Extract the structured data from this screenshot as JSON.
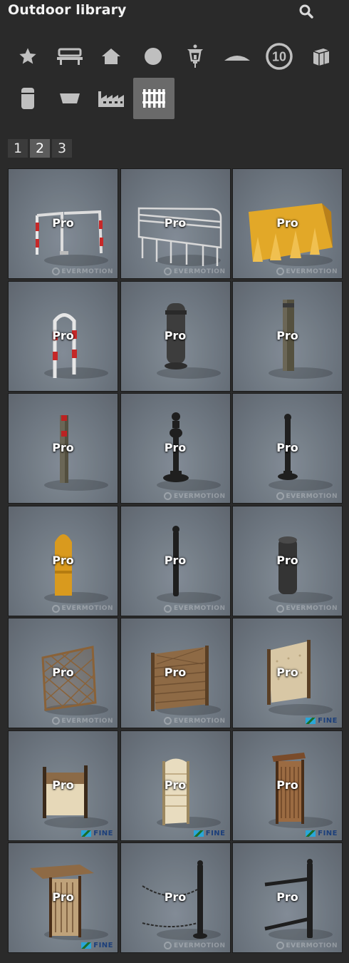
{
  "header": {
    "title": "Outdoor library",
    "search_icon": "search-icon"
  },
  "categories": [
    {
      "name": "favorites",
      "icon": "star-icon",
      "active": false
    },
    {
      "name": "benches",
      "icon": "bench-icon",
      "active": false
    },
    {
      "name": "buildings",
      "icon": "house-icon",
      "active": false
    },
    {
      "name": "round",
      "icon": "circle-icon",
      "active": false
    },
    {
      "name": "lamps",
      "icon": "lantern-icon",
      "active": false
    },
    {
      "name": "canopies",
      "icon": "canopy-icon",
      "active": false
    },
    {
      "name": "signs",
      "icon": "speed-sign-icon",
      "active": false,
      "label": "10"
    },
    {
      "name": "boxes",
      "icon": "box-icon",
      "active": false
    },
    {
      "name": "bins",
      "icon": "bin-icon",
      "active": false
    },
    {
      "name": "planters",
      "icon": "planter-icon",
      "active": false
    },
    {
      "name": "industry",
      "icon": "factory-icon",
      "active": false
    },
    {
      "name": "fences",
      "icon": "fence-icon",
      "active": true
    }
  ],
  "pagination": {
    "pages": [
      "1",
      "2",
      "3"
    ],
    "current": "2"
  },
  "tiles": [
    {
      "label": "Pro",
      "thumb": "barrier-gate",
      "watermark": "EVERMOTION"
    },
    {
      "label": "Pro",
      "thumb": "crowd-barrier",
      "watermark": "EVERMOTION"
    },
    {
      "label": "Pro",
      "thumb": "water-barrier",
      "watermark": "EVERMOTION"
    },
    {
      "label": "Pro",
      "thumb": "u-hoop",
      "watermark": ""
    },
    {
      "label": "Pro",
      "thumb": "round-bollard",
      "watermark": ""
    },
    {
      "label": "Pro",
      "thumb": "square-post",
      "watermark": ""
    },
    {
      "label": "Pro",
      "thumb": "thin-post",
      "watermark": ""
    },
    {
      "label": "Pro",
      "thumb": "ornate-bollard",
      "watermark": "EVERMOTION"
    },
    {
      "label": "Pro",
      "thumb": "slim-bollard",
      "watermark": "EVERMOTION"
    },
    {
      "label": "Pro",
      "thumb": "yellow-bollard",
      "watermark": "EVERMOTION"
    },
    {
      "label": "Pro",
      "thumb": "black-bollard",
      "watermark": "EVERMOTION"
    },
    {
      "label": "Pro",
      "thumb": "cylinder-bollard",
      "watermark": "EVERMOTION"
    },
    {
      "label": "Pro",
      "thumb": "lattice-fence",
      "watermark": "EVERMOTION"
    },
    {
      "label": "Pro",
      "thumb": "plank-fence",
      "watermark": "EVERMOTION"
    },
    {
      "label": "Pro",
      "thumb": "panel-fence",
      "watermark": "FINE"
    },
    {
      "label": "Pro",
      "thumb": "screen-fence",
      "watermark": "FINE"
    },
    {
      "label": "Pro",
      "thumb": "arched-screen",
      "watermark": "FINE"
    },
    {
      "label": "Pro",
      "thumb": "roofed-screen",
      "watermark": "FINE"
    },
    {
      "label": "Pro",
      "thumb": "pergola-gate",
      "watermark": "FINE"
    },
    {
      "label": "Pro",
      "thumb": "chain-post",
      "watermark": "EVERMOTION"
    },
    {
      "label": "Pro",
      "thumb": "rail-post",
      "watermark": "EVERMOTION"
    }
  ],
  "colors": {
    "background": "#2a2a2a",
    "active_category": "#6a6a6a",
    "icon": "#bfbfbf"
  }
}
